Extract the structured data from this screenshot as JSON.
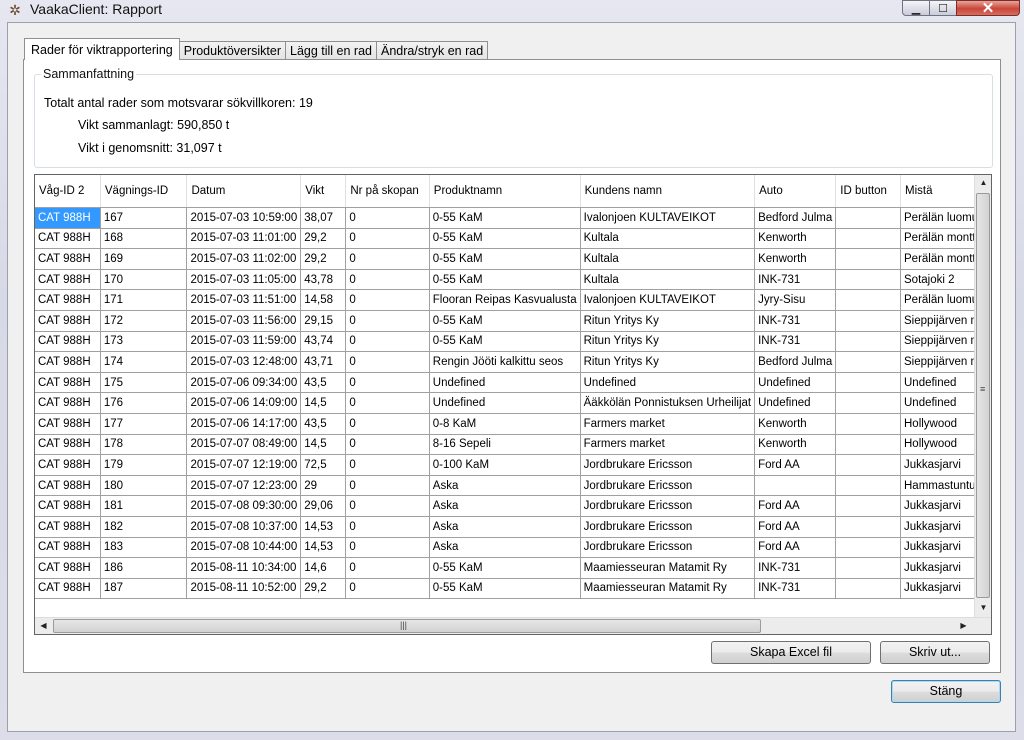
{
  "window": {
    "title": "VaakaClient: Rapport",
    "close_glyph": "✕",
    "min_glyph": "▁",
    "max_glyph": "☐"
  },
  "tabs": [
    "Rader för viktrapportering",
    "Produktöversikter",
    "Lägg till en rad",
    "Ändra/stryk en rad"
  ],
  "summary": {
    "group_title": "Sammanfattning",
    "total_rows": "Totalt antal rader som motsvarar sökvillkoren: 19",
    "total_weight": "Vikt sammanlagt: 590,850 t",
    "avg_weight": "Vikt i genomsnitt: 31,097 t"
  },
  "grid": {
    "columns": [
      "Våg-ID 2",
      "Vägnings-ID",
      "Datum",
      "Vikt",
      "Nr på skopan",
      "Produktnamn",
      "Kundens namn",
      "Auto",
      "ID button",
      "Mistä"
    ],
    "rows": [
      [
        "CAT 988H",
        "167",
        "2015-07-03 10:59:00",
        "38,07",
        "0",
        "0-55 KaM",
        "Ivalonjoen KULTAVEIKOT",
        "Bedford Julma",
        "",
        "Perälän luomuk"
      ],
      [
        "CAT 988H",
        "168",
        "2015-07-03 11:01:00",
        "29,2",
        "0",
        "0-55 KaM",
        "Kultala",
        "Kenworth",
        "",
        "Perälän monttu"
      ],
      [
        "CAT 988H",
        "169",
        "2015-07-03 11:02:00",
        "29,2",
        "0",
        "0-55 KaM",
        "Kultala",
        "Kenworth",
        "",
        "Perälän monttu"
      ],
      [
        "CAT 988H",
        "170",
        "2015-07-03 11:05:00",
        "43,78",
        "0",
        "0-55 KaM",
        "Kultala",
        "INK-731",
        "",
        "Sotajoki 2"
      ],
      [
        "CAT 988H",
        "171",
        "2015-07-03 11:51:00",
        "14,58",
        "0",
        "Flooran Reipas Kasvualusta",
        "Ivalonjoen KULTAVEIKOT",
        "Jyry-Sisu",
        "",
        "Perälän luomuk"
      ],
      [
        "CAT 988H",
        "172",
        "2015-07-03 11:56:00",
        "29,15",
        "0",
        "0-55 KaM",
        "Ritun Yritys Ky",
        "INK-731",
        "",
        "Sieppijärven mo"
      ],
      [
        "CAT 988H",
        "173",
        "2015-07-03 11:59:00",
        "43,74",
        "0",
        "0-55 KaM",
        "Ritun Yritys Ky",
        "INK-731",
        "",
        "Sieppijärven mo"
      ],
      [
        "CAT 988H",
        "174",
        "2015-07-03 12:48:00",
        "43,71",
        "0",
        "Rengin Jööti kalkittu seos",
        "Ritun Yritys Ky",
        "Bedford Julma",
        "",
        "Sieppijärven mo"
      ],
      [
        "CAT 988H",
        "175",
        "2015-07-06 09:34:00",
        "43,5",
        "0",
        "Undefined",
        "Undefined",
        "Undefined",
        "",
        "Undefined"
      ],
      [
        "CAT 988H",
        "176",
        "2015-07-06 14:09:00",
        "14,5",
        "0",
        "Undefined",
        "Ääkkölän Ponnistuksen Urheilijat",
        "Undefined",
        "",
        "Undefined"
      ],
      [
        "CAT 988H",
        "177",
        "2015-07-06 14:17:00",
        "43,5",
        "0",
        "0-8 KaM",
        "Farmers market",
        "Kenworth",
        "",
        "Hollywood"
      ],
      [
        "CAT 988H",
        "178",
        "2015-07-07 08:49:00",
        "14,5",
        "0",
        "8-16 Sepeli",
        "Farmers market",
        "Kenworth",
        "",
        "Hollywood"
      ],
      [
        "CAT 988H",
        "179",
        "2015-07-07 12:19:00",
        "72,5",
        "0",
        "0-100 KaM",
        "Jordbrukare Ericsson",
        "Ford AA",
        "",
        "Jukkasjarvi"
      ],
      [
        "CAT 988H",
        "180",
        "2015-07-07 12:23:00",
        "29",
        "0",
        "Aska",
        "Jordbrukare Ericsson",
        "",
        "",
        "Hammastunturi"
      ],
      [
        "CAT 988H",
        "181",
        "2015-07-08 09:30:00",
        "29,06",
        "0",
        "Aska",
        "Jordbrukare Ericsson",
        "Ford AA",
        "",
        "Jukkasjarvi"
      ],
      [
        "CAT 988H",
        "182",
        "2015-07-08 10:37:00",
        "14,53",
        "0",
        "Aska",
        "Jordbrukare Ericsson",
        "Ford AA",
        "",
        "Jukkasjarvi"
      ],
      [
        "CAT 988H",
        "183",
        "2015-07-08 10:44:00",
        "14,53",
        "0",
        "Aska",
        "Jordbrukare Ericsson",
        "Ford AA",
        "",
        "Jukkasjarvi"
      ],
      [
        "CAT 988H",
        "186",
        "2015-08-11 10:34:00",
        "14,6",
        "0",
        "0-55 KaM",
        "Maamiesseuran Matamit Ry",
        "INK-731",
        "",
        "Jukkasjarvi"
      ],
      [
        "CAT 988H",
        "187",
        "2015-08-11 10:52:00",
        "29,2",
        "0",
        "0-55 KaM",
        "Maamiesseuran Matamit Ry",
        "INK-731",
        "",
        "Jukkasjarvi"
      ]
    ]
  },
  "buttons": {
    "excel": "Skapa Excel fil",
    "print": "Skriv ut...",
    "close": "Stäng"
  }
}
